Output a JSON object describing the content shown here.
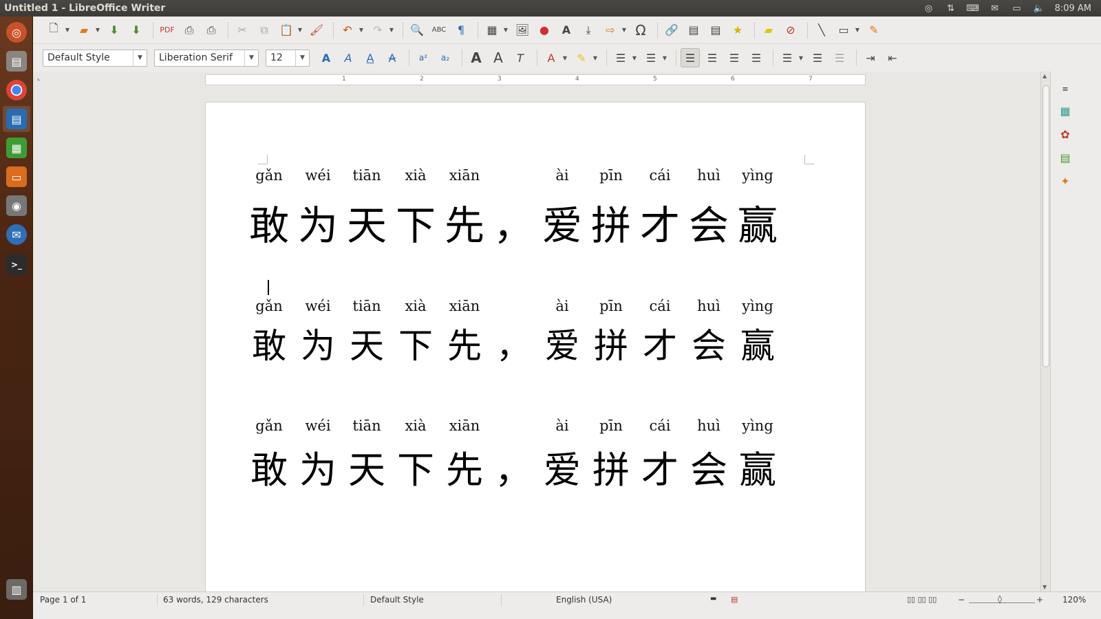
{
  "window": {
    "title": "Untitled 1 - LibreOffice Writer"
  },
  "tray": {
    "clock": "8:09 AM",
    "icons": [
      "chrome-sync-icon",
      "network-arrows-icon",
      "keyboard-input-icon",
      "mail-icon",
      "battery-icon",
      "volume-icon"
    ]
  },
  "launcher": {
    "items": [
      "dash-home",
      "files",
      "chrome",
      "writer",
      "calc",
      "impress",
      "camera",
      "thunderbird",
      "terminal",
      "trash"
    ]
  },
  "toolbar": {
    "paragraph_style": "Default Style",
    "font_name": "Liberation Serif",
    "font_size": "12"
  },
  "ruler": {
    "numbers": [
      "1",
      "2",
      "3",
      "4",
      "5",
      "6",
      "7"
    ]
  },
  "document": {
    "lines": [
      {
        "pinyin": [
          "gǎn",
          "wéi",
          "tiān",
          "xià",
          "xiān",
          "",
          "ài",
          "pīn",
          "cái",
          "huì",
          "yìng"
        ],
        "hanzi": [
          "敢",
          "为",
          "天",
          "下",
          "先",
          "，",
          "爱",
          "拼",
          "才",
          "会",
          "赢"
        ]
      },
      {
        "pinyin": [
          "gǎn",
          "wéi",
          "tiān",
          "xià",
          "xiān",
          "",
          "ài",
          "pīn",
          "cái",
          "huì",
          "yìng"
        ],
        "hanzi": [
          "敢",
          "为",
          "天",
          "下",
          "先",
          "，",
          "爱",
          "拼",
          "才",
          "会",
          "赢"
        ]
      },
      {
        "pinyin": [
          "gǎn",
          "wéi",
          "tiān",
          "xià",
          "xiān",
          "",
          "ài",
          "pīn",
          "cái",
          "huì",
          "yìng"
        ],
        "hanzi": [
          "敢",
          "为",
          "天",
          "下",
          "先",
          "，",
          "爱",
          "拼",
          "才",
          "会",
          "赢"
        ]
      }
    ]
  },
  "status": {
    "page": "Page 1 of 1",
    "words": "63 words, 129 characters",
    "style": "Default Style",
    "language": "English (USA)",
    "zoom": "120%"
  }
}
